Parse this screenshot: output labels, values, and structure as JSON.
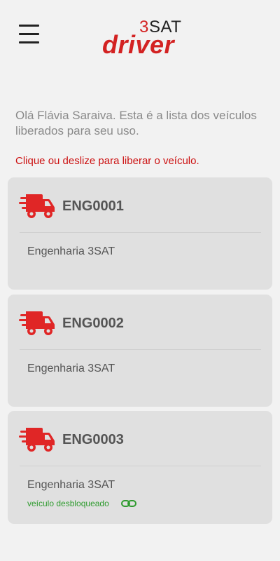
{
  "header": {
    "logo_num": "3",
    "logo_sat": "SAT",
    "logo_driver": "driver"
  },
  "intro": "Olá Flávia Saraiva. Esta é a lista dos veículos liberados para seu uso.",
  "instruction": "Clique ou deslize para liberar o veículo.",
  "vehicles": [
    {
      "plate": "ENG0001",
      "owner": "Engenharia 3SAT"
    },
    {
      "plate": "ENG0002",
      "owner": "Engenharia 3SAT"
    },
    {
      "plate": "ENG0003",
      "owner": "Engenharia 3SAT",
      "status": "veículo desbloqueado"
    }
  ],
  "colors": {
    "accent": "#d32222",
    "unlocked": "#2f9b2f"
  },
  "icons": [
    "menu-icon",
    "delivery-truck-icon",
    "link-icon"
  ]
}
